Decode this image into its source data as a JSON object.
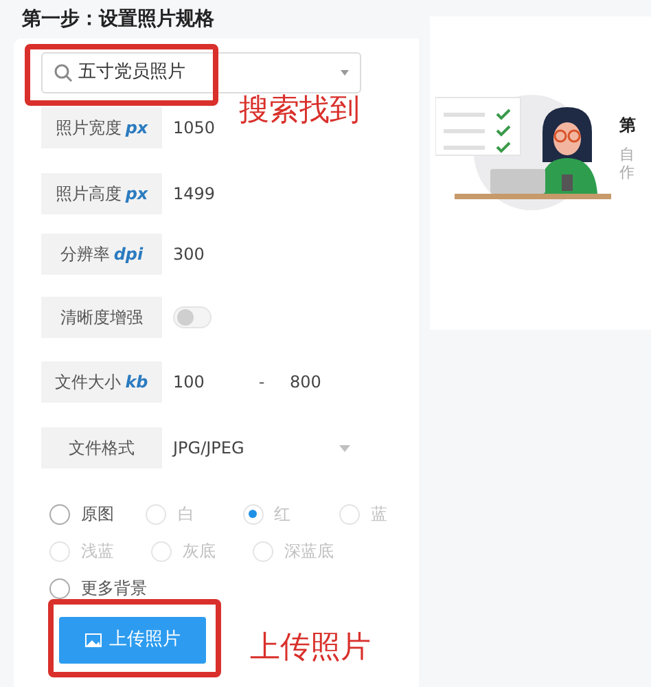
{
  "heading": "第一步：设置照片规格",
  "search": {
    "value": "五寸党员照片"
  },
  "fields": [
    {
      "kind": "text",
      "label": "照片宽度",
      "unit": "px",
      "value": "1050"
    },
    {
      "kind": "text",
      "label": "照片高度",
      "unit": "px",
      "value": "1499"
    },
    {
      "kind": "text",
      "label": "分辨率",
      "unit": "dpi",
      "value": "300"
    },
    {
      "kind": "toggle",
      "label": "清晰度增强",
      "on": false
    },
    {
      "kind": "range",
      "label": "文件大小",
      "unit": "kb",
      "min": "100",
      "separator": "-",
      "max": "800"
    },
    {
      "kind": "select",
      "label": "文件格式",
      "value": "JPG/JPEG"
    }
  ],
  "backgrounds": [
    [
      {
        "label": "原图",
        "selected": false,
        "disabled": false
      },
      {
        "label": "白",
        "selected": false,
        "disabled": true
      },
      {
        "label": "红",
        "selected": true,
        "disabled": true
      },
      {
        "label": "蓝",
        "selected": false,
        "disabled": true
      }
    ],
    [
      {
        "label": "浅蓝",
        "selected": false,
        "disabled": true
      },
      {
        "label": "灰底",
        "selected": false,
        "disabled": true
      },
      {
        "label": "深蓝底",
        "selected": false,
        "disabled": true
      }
    ],
    [
      {
        "label": "更多背景",
        "selected": false,
        "disabled": false
      }
    ]
  ],
  "upload_button": "上传照片",
  "annotations": [
    "搜索找到",
    "上传照片"
  ],
  "side_card": {
    "title": "第",
    "description": [
      "自",
      "作"
    ]
  }
}
